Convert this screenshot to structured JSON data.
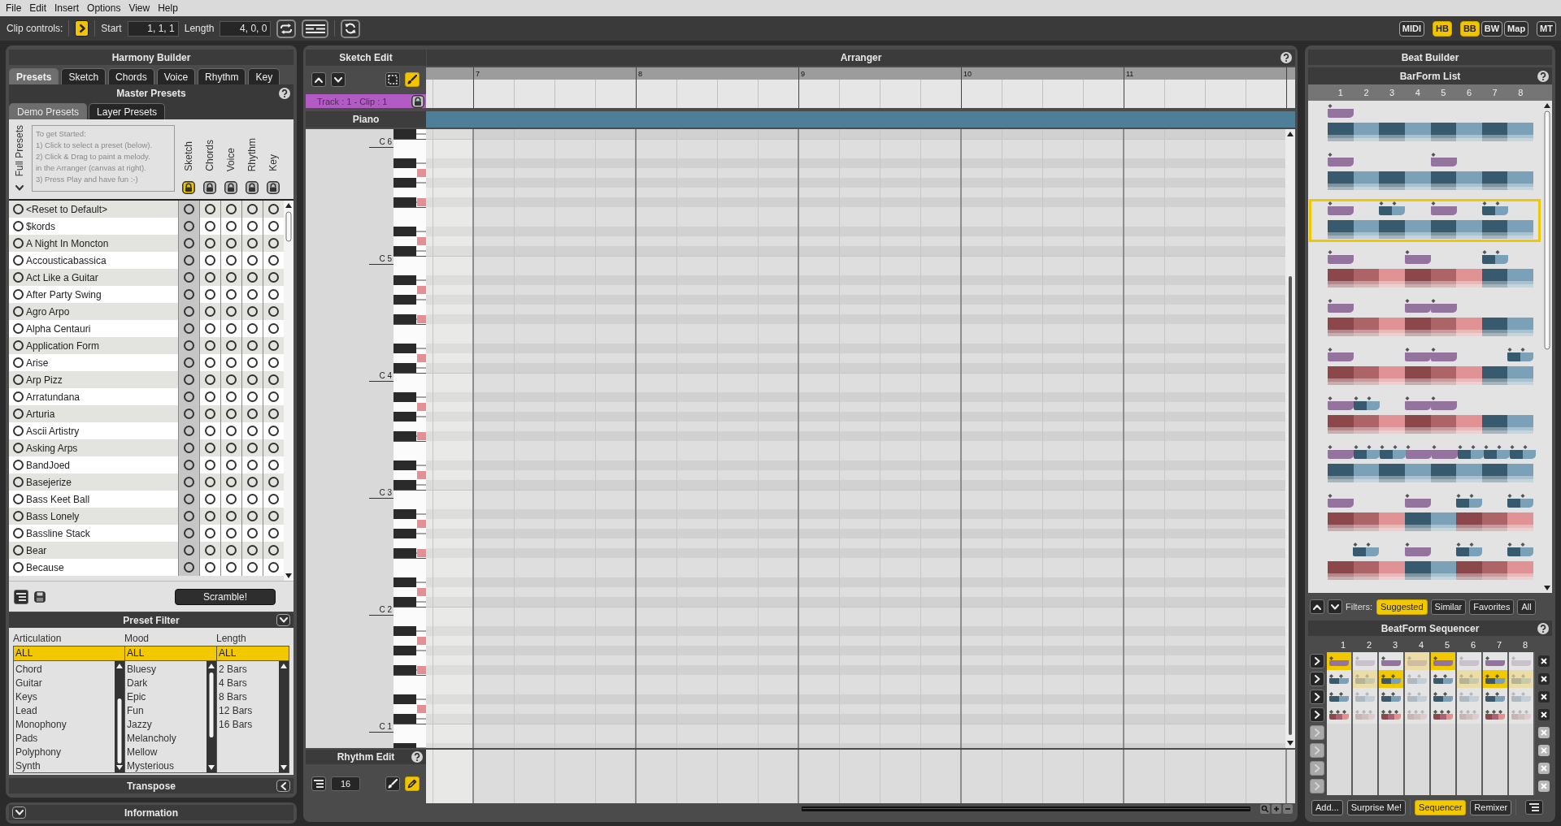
{
  "menu": [
    "File",
    "Edit",
    "Insert",
    "Options",
    "View",
    "Help"
  ],
  "toolbar": {
    "label": "Clip controls:",
    "play_on": true,
    "start_label": "Start",
    "start": "1, 1, 1",
    "length_label": "Length",
    "length": "4, 0, 0",
    "toggle_groups": [
      {
        "buttons": [
          {
            "label": "MIDI",
            "on": false
          }
        ]
      },
      {
        "buttons": [
          {
            "label": "HB",
            "on": true
          }
        ]
      },
      {
        "buttons": [
          {
            "label": "BB",
            "on": true
          },
          {
            "label": "BW",
            "on": false
          },
          {
            "label": "Map",
            "on": false
          }
        ]
      },
      {
        "buttons": [
          {
            "label": "MT",
            "on": false
          }
        ]
      }
    ]
  },
  "harmony_builder": {
    "title": "Harmony Builder",
    "tabs": [
      {
        "label": "Presets",
        "selected": true
      },
      {
        "label": "Sketch",
        "selected": false
      },
      {
        "label": "Chords",
        "selected": false
      },
      {
        "label": "Voice",
        "selected": false
      },
      {
        "label": "Rhythm",
        "selected": false
      },
      {
        "label": "Key",
        "selected": false
      }
    ],
    "section": "Master Presets",
    "subtabs": [
      {
        "label": "Demo Presets",
        "selected": true
      },
      {
        "label": "Layer Presets",
        "selected": false
      }
    ],
    "side_label": "Full Presets",
    "instructions": [
      "To get Started:",
      "1) Click to select a preset (below).",
      "2) Click & Drag to paint a melody.",
      "in the Arranger (canvas at right).",
      "3) Press Play and have fun :-)"
    ],
    "layer_columns": [
      {
        "label": "Sketch",
        "locked": true
      },
      {
        "label": "Chords",
        "locked": false
      },
      {
        "label": "Voice",
        "locked": false
      },
      {
        "label": "Rhythm",
        "locked": false
      },
      {
        "label": "Key",
        "locked": false
      }
    ],
    "presets": [
      {
        "name": "<Reset to Default>",
        "selected": false,
        "layers": [
          false,
          false,
          false,
          false,
          false
        ]
      },
      {
        "name": "$kords",
        "selected": false,
        "layers": [
          false,
          false,
          false,
          false,
          false
        ]
      },
      {
        "name": "A Night In Moncton",
        "selected": false,
        "layers": [
          false,
          false,
          false,
          false,
          false
        ]
      },
      {
        "name": "Accousticabassica",
        "selected": false,
        "layers": [
          false,
          false,
          false,
          false,
          false
        ]
      },
      {
        "name": "Act Like a Guitar",
        "selected": false,
        "layers": [
          false,
          false,
          false,
          false,
          false
        ]
      },
      {
        "name": "After Party Swing",
        "selected": false,
        "layers": [
          false,
          false,
          false,
          false,
          false
        ]
      },
      {
        "name": "Agro Arpo",
        "selected": false,
        "layers": [
          false,
          false,
          false,
          false,
          false
        ]
      },
      {
        "name": "Alpha Centauri",
        "selected": false,
        "layers": [
          false,
          false,
          false,
          false,
          false
        ]
      },
      {
        "name": "Application Form",
        "selected": false,
        "layers": [
          false,
          false,
          false,
          false,
          false
        ]
      },
      {
        "name": "Arise",
        "selected": false,
        "layers": [
          false,
          false,
          false,
          false,
          false
        ]
      },
      {
        "name": "Arp Pizz",
        "selected": false,
        "layers": [
          false,
          false,
          false,
          false,
          false
        ]
      },
      {
        "name": "Arratundana",
        "selected": false,
        "layers": [
          false,
          false,
          false,
          false,
          false
        ]
      },
      {
        "name": "Arturia",
        "selected": false,
        "layers": [
          false,
          false,
          false,
          false,
          false
        ]
      },
      {
        "name": "Ascii Artistry",
        "selected": false,
        "layers": [
          false,
          false,
          false,
          false,
          false
        ]
      },
      {
        "name": "Asking Arps",
        "selected": false,
        "layers": [
          false,
          false,
          false,
          false,
          false
        ]
      },
      {
        "name": "BandJoed",
        "selected": false,
        "layers": [
          false,
          false,
          false,
          false,
          false
        ]
      },
      {
        "name": "Basejerize",
        "selected": false,
        "layers": [
          false,
          false,
          false,
          false,
          false
        ]
      },
      {
        "name": "Bass Keet Ball",
        "selected": false,
        "layers": [
          false,
          false,
          false,
          false,
          false
        ]
      },
      {
        "name": "Bass Lonely",
        "selected": false,
        "layers": [
          false,
          false,
          false,
          false,
          false
        ]
      },
      {
        "name": "Bassline Stack",
        "selected": false,
        "layers": [
          false,
          false,
          false,
          false,
          false
        ]
      },
      {
        "name": "Bear",
        "selected": false,
        "layers": [
          false,
          false,
          false,
          false,
          false
        ]
      },
      {
        "name": "Because",
        "selected": false,
        "layers": [
          false,
          false,
          false,
          false,
          false
        ]
      }
    ],
    "scramble": "Scramble!",
    "filter": {
      "title": "Preset Filter",
      "expanded": true,
      "columns": [
        {
          "label": "Articulation",
          "items": [
            {
              "label": "ALL",
              "selected": true
            },
            {
              "label": "Chord",
              "selected": false
            },
            {
              "label": "Guitar",
              "selected": false
            },
            {
              "label": "Keys",
              "selected": false
            },
            {
              "label": "Lead",
              "selected": false
            },
            {
              "label": "Monophony",
              "selected": false
            },
            {
              "label": "Pads",
              "selected": false
            },
            {
              "label": "Polyphony",
              "selected": false
            },
            {
              "label": "Synth",
              "selected": false
            }
          ]
        },
        {
          "label": "Mood",
          "items": [
            {
              "label": "ALL",
              "selected": true
            },
            {
              "label": "Bluesy",
              "selected": false
            },
            {
              "label": "Dark",
              "selected": false
            },
            {
              "label": "Epic",
              "selected": false
            },
            {
              "label": "Fun",
              "selected": false
            },
            {
              "label": "Jazzy",
              "selected": false
            },
            {
              "label": "Melancholy",
              "selected": false
            },
            {
              "label": "Mellow",
              "selected": false
            },
            {
              "label": "Mysterious",
              "selected": false
            }
          ]
        },
        {
          "label": "Length",
          "items": [
            {
              "label": "ALL",
              "selected": true
            },
            {
              "label": "2 Bars",
              "selected": false
            },
            {
              "label": "4 Bars",
              "selected": false
            },
            {
              "label": "8 Bars",
              "selected": false
            },
            {
              "label": "12 Bars",
              "selected": false
            },
            {
              "label": "16 Bars",
              "selected": false
            }
          ]
        }
      ]
    },
    "transpose": {
      "title": "Transpose",
      "expanded": false
    }
  },
  "information": {
    "title": "Information"
  },
  "sketch_edit": {
    "title": "Sketch Edit",
    "select_on": false,
    "brush_on": true,
    "track": "Track : 1 - Clip : 1",
    "instrument": "Piano"
  },
  "arranger": {
    "title": "Arranger",
    "bars": [
      "7",
      "8",
      "9",
      "10",
      "11"
    ],
    "octaves": [
      "C 6",
      "C 5",
      "C 4",
      "C 3",
      "C 2",
      "C 1"
    ]
  },
  "rhythm_edit": {
    "title": "Rhythm Edit",
    "steps": "16",
    "brush_on": false,
    "pencil_on": true
  },
  "beat_builder": {
    "title": "Beat Builder",
    "list_title": "BarForm List",
    "columns": [
      "1",
      "2",
      "3",
      "4",
      "5",
      "6",
      "7",
      "8"
    ],
    "barforms": [
      {
        "selected": false,
        "hits": [
          {
            "kind": "single"
          },
          {
            "kind": "none"
          },
          {
            "kind": "none"
          },
          {
            "kind": "none"
          },
          {
            "kind": "none"
          },
          {
            "kind": "none"
          },
          {
            "kind": "none"
          },
          {
            "kind": "none"
          }
        ],
        "beats": [
          {
            "color": "#385a6e"
          },
          {
            "color": "#7aa1b8"
          },
          {
            "color": "#385a6e"
          },
          {
            "color": "#7aa1b8"
          },
          {
            "color": "#385a6e"
          },
          {
            "color": "#7aa1b8"
          },
          {
            "color": "#385a6e"
          },
          {
            "color": "#7aa1b8"
          }
        ]
      },
      {
        "selected": false,
        "hits": [
          {
            "kind": "single"
          },
          {
            "kind": "none"
          },
          {
            "kind": "none"
          },
          {
            "kind": "none"
          },
          {
            "kind": "single"
          },
          {
            "kind": "none"
          },
          {
            "kind": "none"
          },
          {
            "kind": "none"
          }
        ],
        "beats": [
          {
            "color": "#385a6e"
          },
          {
            "color": "#7aa1b8"
          },
          {
            "color": "#385a6e"
          },
          {
            "color": "#7aa1b8"
          },
          {
            "color": "#385a6e"
          },
          {
            "color": "#7aa1b8"
          },
          {
            "color": "#385a6e"
          },
          {
            "color": "#7aa1b8"
          }
        ]
      },
      {
        "selected": true,
        "hits": [
          {
            "kind": "single"
          },
          {
            "kind": "none"
          },
          {
            "kind": "split"
          },
          {
            "kind": "none"
          },
          {
            "kind": "single"
          },
          {
            "kind": "none"
          },
          {
            "kind": "split"
          },
          {
            "kind": "none"
          }
        ],
        "beats": [
          {
            "color": "#385a6e"
          },
          {
            "color": "#7aa1b8"
          },
          {
            "color": "#385a6e"
          },
          {
            "color": "#7aa1b8"
          },
          {
            "color": "#385a6e"
          },
          {
            "color": "#7aa1b8"
          },
          {
            "color": "#385a6e"
          },
          {
            "color": "#7aa1b8"
          }
        ]
      },
      {
        "selected": false,
        "hits": [
          {
            "kind": "single"
          },
          {
            "kind": "none"
          },
          {
            "kind": "none"
          },
          {
            "kind": "single"
          },
          {
            "kind": "none"
          },
          {
            "kind": "none"
          },
          {
            "kind": "split"
          },
          {
            "kind": "none"
          }
        ],
        "beats": [
          {
            "color": "#8c474b"
          },
          {
            "color": "#ad6467"
          },
          {
            "color": "#e09294"
          },
          {
            "color": "#8c474b"
          },
          {
            "color": "#ad6467"
          },
          {
            "color": "#e09294"
          },
          {
            "color": "#385a6e"
          },
          {
            "color": "#7aa1b8"
          }
        ]
      },
      {
        "selected": false,
        "hits": [
          {
            "kind": "single"
          },
          {
            "kind": "none"
          },
          {
            "kind": "none"
          },
          {
            "kind": "single"
          },
          {
            "kind": "single"
          },
          {
            "kind": "none"
          },
          {
            "kind": "none"
          },
          {
            "kind": "none"
          }
        ],
        "beats": [
          {
            "color": "#8c474b"
          },
          {
            "color": "#ad6467"
          },
          {
            "color": "#e09294"
          },
          {
            "color": "#8c474b"
          },
          {
            "color": "#ad6467"
          },
          {
            "color": "#e09294"
          },
          {
            "color": "#385a6e"
          },
          {
            "color": "#7aa1b8"
          }
        ]
      },
      {
        "selected": false,
        "hits": [
          {
            "kind": "single"
          },
          {
            "kind": "none"
          },
          {
            "kind": "none"
          },
          {
            "kind": "single"
          },
          {
            "kind": "single"
          },
          {
            "kind": "none"
          },
          {
            "kind": "none"
          },
          {
            "kind": "split"
          }
        ],
        "beats": [
          {
            "color": "#8c474b"
          },
          {
            "color": "#ad6467"
          },
          {
            "color": "#e09294"
          },
          {
            "color": "#8c474b"
          },
          {
            "color": "#ad6467"
          },
          {
            "color": "#e09294"
          },
          {
            "color": "#385a6e"
          },
          {
            "color": "#7aa1b8"
          }
        ]
      },
      {
        "selected": false,
        "hits": [
          {
            "kind": "single"
          },
          {
            "kind": "split"
          },
          {
            "kind": "none"
          },
          {
            "kind": "single"
          },
          {
            "kind": "single"
          },
          {
            "kind": "none"
          },
          {
            "kind": "none"
          },
          {
            "kind": "none"
          }
        ],
        "beats": [
          {
            "color": "#8c474b"
          },
          {
            "color": "#ad6467"
          },
          {
            "color": "#e09294"
          },
          {
            "color": "#8c474b"
          },
          {
            "color": "#ad6467"
          },
          {
            "color": "#e09294"
          },
          {
            "color": "#385a6e"
          },
          {
            "color": "#7aa1b8"
          }
        ]
      },
      {
        "selected": false,
        "hits": [
          {
            "kind": "single"
          },
          {
            "kind": "split"
          },
          {
            "kind": "split"
          },
          {
            "kind": "single"
          },
          {
            "kind": "single"
          },
          {
            "kind": "split"
          },
          {
            "kind": "split"
          },
          {
            "kind": "split"
          }
        ],
        "beats": [
          {
            "color": "#385a6e"
          },
          {
            "color": "#7aa1b8"
          },
          {
            "color": "#385a6e"
          },
          {
            "color": "#7aa1b8"
          },
          {
            "color": "#385a6e"
          },
          {
            "color": "#7aa1b8"
          },
          {
            "color": "#385a6e"
          },
          {
            "color": "#7aa1b8"
          }
        ]
      },
      {
        "selected": false,
        "hits": [
          {
            "kind": "single"
          },
          {
            "kind": "none"
          },
          {
            "kind": "none"
          },
          {
            "kind": "single"
          },
          {
            "kind": "none"
          },
          {
            "kind": "split"
          },
          {
            "kind": "none"
          },
          {
            "kind": "split"
          }
        ],
        "beats": [
          {
            "color": "#8c474b"
          },
          {
            "color": "#ad6467"
          },
          {
            "color": "#e09294"
          },
          {
            "color": "#385a6e"
          },
          {
            "color": "#7aa1b8"
          },
          {
            "color": "#8c474b"
          },
          {
            "color": "#ad6467"
          },
          {
            "color": "#e09294"
          }
        ]
      },
      {
        "selected": false,
        "hits": [
          {
            "kind": "none"
          },
          {
            "kind": "split"
          },
          {
            "kind": "none"
          },
          {
            "kind": "single"
          },
          {
            "kind": "none"
          },
          {
            "kind": "split"
          },
          {
            "kind": "none"
          },
          {
            "kind": "split"
          }
        ],
        "beats": [
          {
            "color": "#8c474b"
          },
          {
            "color": "#ad6467"
          },
          {
            "color": "#e09294"
          },
          {
            "color": "#385a6e"
          },
          {
            "color": "#7aa1b8"
          },
          {
            "color": "#8c474b"
          },
          {
            "color": "#ad6467"
          },
          {
            "color": "#e09294"
          }
        ]
      }
    ],
    "filters_label": "Filters:",
    "filters": [
      {
        "label": "Suggested",
        "selected": true
      },
      {
        "label": "Similar",
        "selected": false
      },
      {
        "label": "Favorites",
        "selected": false
      },
      {
        "label": "All",
        "selected": false
      }
    ],
    "sequencer": {
      "title": "BeatForm Sequencer",
      "columns": [
        "1",
        "2",
        "3",
        "4",
        "5",
        "6",
        "7",
        "8"
      ],
      "tracks": [
        {
          "kind": "single",
          "cells": [
            {
              "on": true,
              "selected": true
            },
            {
              "on": false,
              "selected": false
            },
            {
              "on": true,
              "selected": false
            },
            {
              "on": false,
              "selected": true
            },
            {
              "on": true,
              "selected": true
            },
            {
              "on": false,
              "selected": false
            },
            {
              "on": true,
              "selected": false
            },
            {
              "on": false,
              "selected": false
            }
          ]
        },
        {
          "kind": "split",
          "cells": [
            {
              "on": true,
              "selected": false
            },
            {
              "on": false,
              "selected": true
            },
            {
              "on": true,
              "selected": true
            },
            {
              "on": false,
              "selected": false
            },
            {
              "on": true,
              "selected": false
            },
            {
              "on": false,
              "selected": true
            },
            {
              "on": true,
              "selected": true
            },
            {
              "on": false,
              "selected": true
            }
          ]
        },
        {
          "kind": "split",
          "cells": [
            {
              "on": true,
              "selected": false
            },
            {
              "on": false,
              "selected": false
            },
            {
              "on": true,
              "selected": false
            },
            {
              "on": false,
              "selected": false
            },
            {
              "on": true,
              "selected": false
            },
            {
              "on": false,
              "selected": false
            },
            {
              "on": true,
              "selected": false
            },
            {
              "on": false,
              "selected": false
            }
          ]
        },
        {
          "kind": "triple",
          "cells": [
            {
              "on": true,
              "selected": false
            },
            {
              "on": false,
              "selected": false
            },
            {
              "on": true,
              "selected": false
            },
            {
              "on": false,
              "selected": false
            },
            {
              "on": true,
              "selected": false
            },
            {
              "on": false,
              "selected": false
            },
            {
              "on": true,
              "selected": false
            },
            {
              "on": false,
              "selected": false
            }
          ]
        },
        {
          "kind": "empty"
        },
        {
          "kind": "empty"
        },
        {
          "kind": "empty"
        },
        {
          "kind": "empty"
        }
      ]
    },
    "buttons": [
      {
        "label": "Add...",
        "selected": false
      },
      {
        "label": "Surprise Me!",
        "selected": false
      },
      {
        "label": "Sequencer",
        "selected": true
      },
      {
        "label": "Remixer",
        "selected": false
      }
    ]
  }
}
